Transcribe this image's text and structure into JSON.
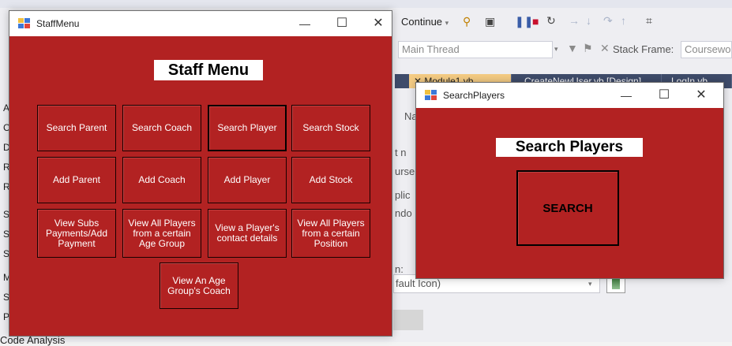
{
  "ide": {
    "toolbar": {
      "continue_label": "Continue",
      "continue_arrow": "▾"
    },
    "row2": {
      "thread_value": "Main Thread",
      "stack_frame_label": "Stack Frame:",
      "stack_frame_value": "Coursework_S"
    },
    "tabs": [
      "Module1.vb",
      "CreateNewUser.vb [Design]",
      "LogIn.vb"
    ],
    "partial_props": [
      "Na",
      "t n",
      "urse",
      "plic",
      "ndo",
      "n:"
    ],
    "icon_value": "fault Icon)",
    "code_analysis": "Code Analysis",
    "left_letters": [
      "A",
      "C",
      "D",
      "R",
      "R",
      "S",
      "S",
      "S",
      "M",
      "S",
      "P"
    ]
  },
  "staff_menu": {
    "title": "StaffMenu",
    "heading": "Staff Menu",
    "buttons": [
      [
        "Search Parent",
        "Search Coach",
        "Search Player",
        "Search Stock"
      ],
      [
        "Add Parent",
        "Add Coach",
        "Add Player",
        "Add Stock"
      ],
      [
        "View Subs Payments/Add Payment",
        "View All Players from a certain Age Group",
        "View a Player's contact details",
        "View All Players from a certain Position"
      ]
    ],
    "last_button": "View An Age Group's Coach"
  },
  "search_players": {
    "title": "SearchPlayers",
    "heading": "Search Players",
    "search_button": "SEARCH"
  },
  "window_controls": {
    "minimize": "—",
    "maximize": "☐",
    "close": "✕"
  },
  "colors": {
    "form_background": "#b22222",
    "ide_background": "#eeeef2",
    "tab_strip": "#3f4c6b",
    "active_tab": "#f5cc84"
  }
}
